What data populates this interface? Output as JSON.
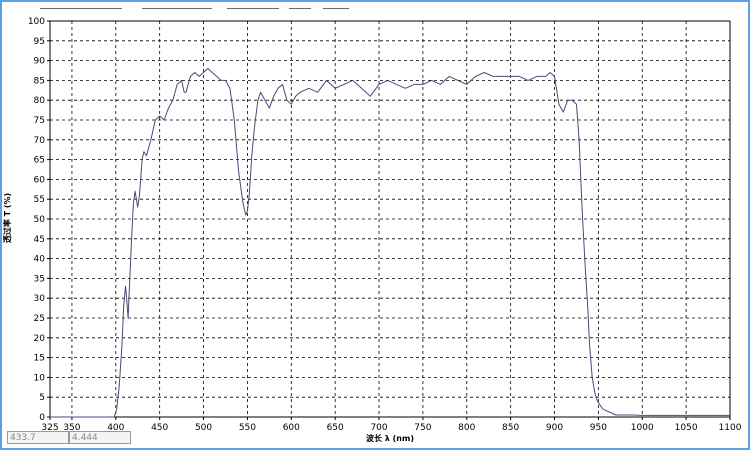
{
  "chart_data": {
    "type": "line",
    "title": "",
    "xlabel": "波长 λ (nm)",
    "ylabel": "透过率 T (%)",
    "xlim": [
      325,
      1100
    ],
    "ylim": [
      0,
      100
    ],
    "x_tick_labels": [
      "325",
      "350",
      "400",
      "450",
      "500",
      "550",
      "600",
      "650",
      "700",
      "750",
      "800",
      "850",
      "900",
      "950",
      "1000",
      "1050",
      "1100"
    ],
    "y_tick_labels": [
      "0",
      "5",
      "10",
      "15",
      "20",
      "25",
      "30",
      "35",
      "40",
      "45",
      "50",
      "55",
      "60",
      "65",
      "70",
      "75",
      "80",
      "85",
      "90",
      "95",
      "100"
    ],
    "grid": true,
    "colors": {
      "line": "#4a4a78",
      "grid": "#000000",
      "frame": "#5aa0e6"
    },
    "series": [
      {
        "x": [
          325,
          360,
          398,
          401,
          404,
          407,
          409,
          411,
          412,
          414,
          416,
          418,
          420,
          422,
          425,
          427,
          430,
          432,
          435,
          440,
          445,
          450,
          455,
          460,
          465,
          470,
          475,
          478,
          480,
          485,
          490,
          495,
          500,
          505,
          510,
          515,
          520,
          525,
          530,
          535,
          540,
          545,
          548,
          550,
          552,
          555,
          558,
          562,
          565,
          570,
          575,
          580,
          585,
          590,
          595,
          600,
          605,
          610,
          620,
          630,
          640,
          650,
          660,
          670,
          680,
          690,
          700,
          710,
          720,
          730,
          740,
          750,
          760,
          770,
          780,
          790,
          800,
          810,
          820,
          830,
          840,
          850,
          860,
          870,
          880,
          890,
          895,
          900,
          905,
          910,
          915,
          920,
          925,
          928,
          930,
          932,
          935,
          938,
          940,
          943,
          946,
          949,
          952,
          955,
          960,
          965,
          970,
          980,
          990,
          1000,
          1020,
          1050,
          1080,
          1090,
          1100
        ],
        "y": [
          0,
          0,
          0,
          2,
          8,
          18,
          28,
          33,
          31,
          25,
          35,
          45,
          54,
          57,
          53,
          56,
          65,
          67,
          66,
          70,
          75,
          76,
          75,
          78,
          80,
          84,
          85,
          82,
          82,
          86,
          87,
          86,
          87,
          88,
          87,
          86,
          85,
          85,
          83,
          75,
          62,
          54,
          51,
          52,
          56,
          66,
          73,
          80,
          82,
          80,
          78,
          81,
          83,
          84,
          80,
          79,
          81,
          82,
          83,
          82,
          85,
          83,
          84,
          85,
          83,
          81,
          84,
          85,
          84,
          83,
          84,
          84,
          85,
          84,
          86,
          85,
          84,
          86,
          87,
          86,
          86,
          86,
          86,
          85,
          86,
          86,
          87,
          86,
          79,
          77,
          80,
          80,
          79,
          70,
          60,
          50,
          38,
          27,
          18,
          10,
          6,
          4,
          3,
          2,
          1.5,
          1,
          0.5,
          0.5,
          0.5,
          0.4,
          0.4,
          0.4,
          0.4,
          0.4,
          0.4
        ]
      }
    ]
  },
  "readouts": {
    "x_value": "433.7",
    "y_value": "4.444"
  }
}
